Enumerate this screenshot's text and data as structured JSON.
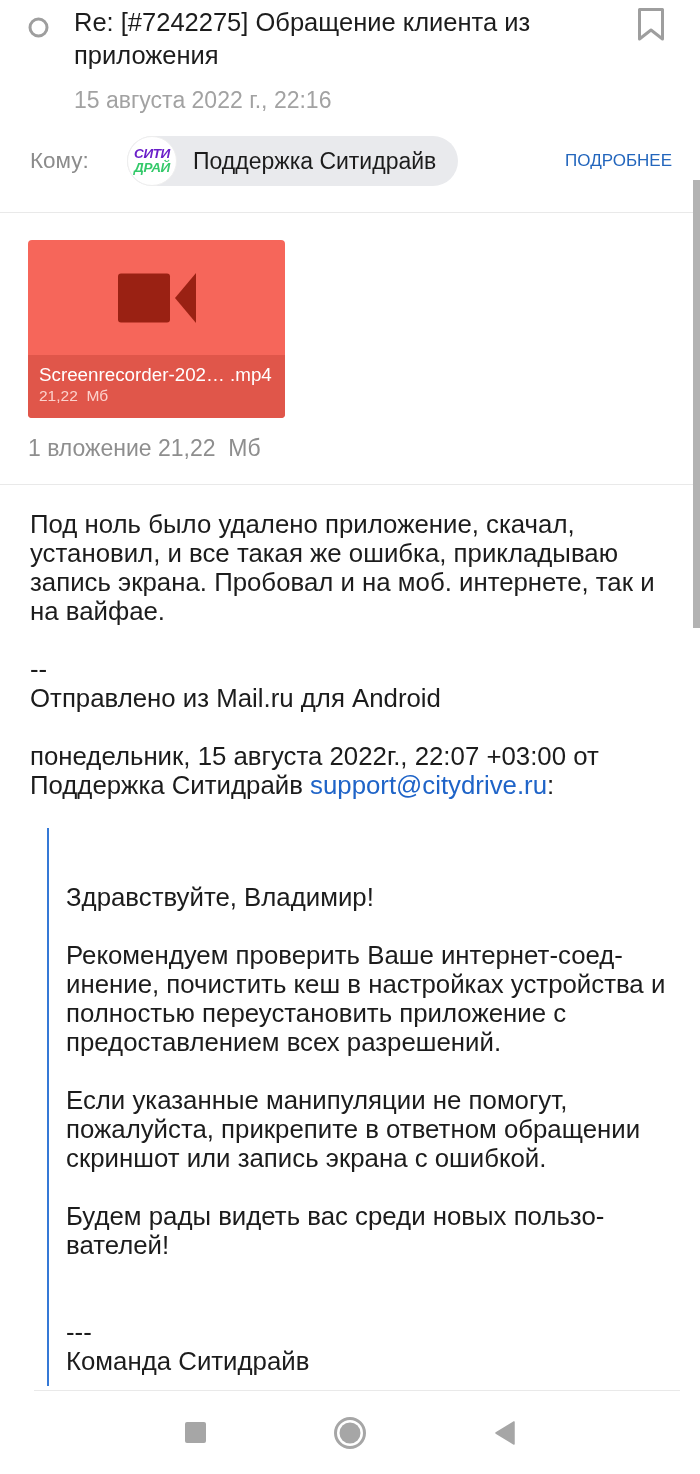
{
  "header": {
    "unread": false,
    "subject": "Re: [#7242275] Обращение клиента из приложения",
    "flagged": false,
    "date": "15 августа 2022 г., 22:16"
  },
  "recipients": {
    "label": "Кому:",
    "contacts": [
      {
        "name": "Поддержка Ситидрайв",
        "logo_lines": [
          "СИТИ",
          "ДРАЙ"
        ]
      }
    ],
    "details_link": "ПОДРОБНЕЕ"
  },
  "attachments": {
    "files": [
      {
        "kind": "video",
        "name": "Screenrecorder-202… .mp4",
        "size": "21,22  Мб"
      }
    ],
    "summary": "1 вложение 21,22  Мб"
  },
  "message": {
    "paragraphs": [
      "Под ноль было удалено приложение, скачал,\nустановил, и все такая же ошибка, прикладываю\nзапись экрана. Пробовал и на моб. интернете, так и\nна вайфае."
    ],
    "signature_separator": "--",
    "signature": "Отправлено из Mail.ru для Android",
    "quote_intro": {
      "text": "понедельник, 15 августа 2022г., 22:07 +03:00 от\nПоддержка Ситидрайв",
      "email": "support@citydrive.ru",
      "after": ":"
    }
  },
  "quote": {
    "greeting": "Здравствуйте, Владимир!",
    "paragraphs": [
      "Рекомендуем проверить Ваше интернет-соед-\nинение, почистить кеш в настройках устройства и\nполностью переустановить приложение с\nпредоставлением всех разрешений.",
      "Если указанные манипуляции не помогут,\nпожалуйста, прикрепите в ответном обращении\nскриншот или запись экрана с ошибкой.",
      "Будем рады видеть вас среди новых пользо-\nвателей!"
    ],
    "separator": "---",
    "signature": "Команда Ситидрайв"
  }
}
